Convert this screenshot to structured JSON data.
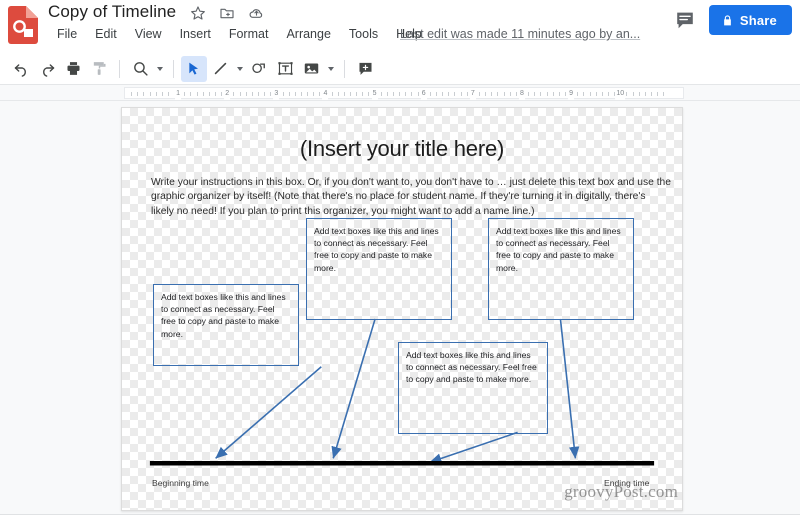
{
  "app": {
    "logo_icon": "google-drawings-logo",
    "title": "Copy of Timeline",
    "title_icons": [
      {
        "icon": "star-icon",
        "name": "star-outline-icon"
      },
      {
        "icon": "move-to-folder-icon",
        "name": "move-to-folder-icon"
      },
      {
        "icon": "cloud-saved-icon",
        "name": "cloud-saved-icon"
      }
    ],
    "menus": [
      "File",
      "Edit",
      "View",
      "Insert",
      "Format",
      "Arrange",
      "Tools",
      "Help"
    ],
    "last_edit": "Last edit was made 11 minutes ago by an...",
    "comment_icon": "comment-icon",
    "share_label": "Share",
    "share_icon": "lock-icon",
    "share_color": "#1a73e8"
  },
  "toolbar": {
    "items": [
      {
        "name": "undo-button",
        "icon": "undo-icon",
        "state": "normal"
      },
      {
        "name": "redo-button",
        "icon": "redo-icon",
        "state": "normal"
      },
      {
        "name": "print-button",
        "icon": "print-icon",
        "state": "normal"
      },
      {
        "name": "paint-format-button",
        "icon": "paint-format-icon",
        "state": "disabled"
      },
      {
        "name": "zoom-button",
        "icon": "zoom-icon",
        "state": "normal",
        "has_caret": true
      },
      {
        "name": "select-tool-button",
        "icon": "cursor-arrow-icon",
        "state": "active"
      },
      {
        "name": "line-tool-button",
        "icon": "line-icon",
        "state": "normal",
        "has_caret": true
      },
      {
        "name": "shape-tool-button",
        "icon": "shape-icon",
        "state": "normal"
      },
      {
        "name": "text-box-tool-button",
        "icon": "text-box-icon",
        "state": "normal"
      },
      {
        "name": "image-tool-button",
        "icon": "image-icon",
        "state": "normal",
        "has_caret": true
      },
      {
        "name": "comment-tool-button",
        "icon": "add-comment-icon",
        "state": "normal"
      }
    ]
  },
  "ruler": {
    "unit_labels": [
      "1",
      "2",
      "3",
      "4",
      "5",
      "6",
      "7",
      "8",
      "9",
      "10"
    ]
  },
  "canvas": {
    "slide_title": "(Insert your title here)",
    "instructions": "Write your instructions in this box. Or, if you don't want to, you don't have to … just delete this text box and use the graphic organizer by itself! (Note that there's no place for student name. If they're turning it in digitally, there's likely no need! If you plan to print this organizer, you might want to add a name line.)",
    "text_boxes": [
      {
        "id": "left",
        "text": "Add text boxes like this and lines to connect as necessary. Feel free to copy and paste to make more."
      },
      {
        "id": "center-top",
        "text": "Add text boxes like this and lines to connect as necessary. Feel free to copy and paste to make more."
      },
      {
        "id": "right",
        "text": "Add text boxes like this and lines to connect as necessary. Feel free to copy and paste to make more."
      },
      {
        "id": "center-bottom",
        "text": "Add text boxes like this and lines to connect as necessary. Feel free to copy and paste to make more."
      }
    ],
    "timeline": {
      "start_label": "Beginning time",
      "end_label": "Ending time",
      "line_color": "#000000",
      "arrow_color": "#3a6fb0",
      "box_border_color": "#3a6fb0"
    },
    "watermark": "groovyPost.com"
  }
}
